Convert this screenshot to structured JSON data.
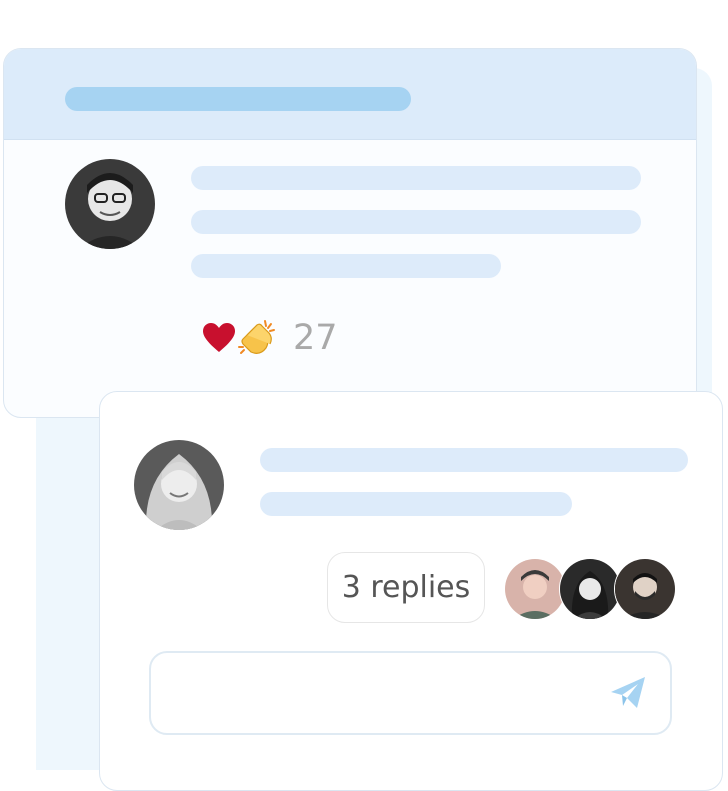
{
  "post": {
    "reactions": {
      "icons": [
        "heart-icon",
        "clapping-hands-icon"
      ],
      "count": "27"
    }
  },
  "reply": {
    "replies_label": "3 replies",
    "reply_avatar_icons": [
      "avatar-man-cap",
      "avatar-woman-dark-hair",
      "avatar-man-beard"
    ]
  },
  "composer": {
    "value": "",
    "placeholder": "",
    "send_icon": "send-icon"
  },
  "colors": {
    "header_bg": "#dcebfa",
    "header_bar": "#a6d3f2",
    "placeholder_line": "#ddebfa",
    "heart": "#c8102e",
    "clap": "#fbbf24",
    "count_text": "#a9a9a9",
    "send_icon": "#a6d3f2"
  }
}
